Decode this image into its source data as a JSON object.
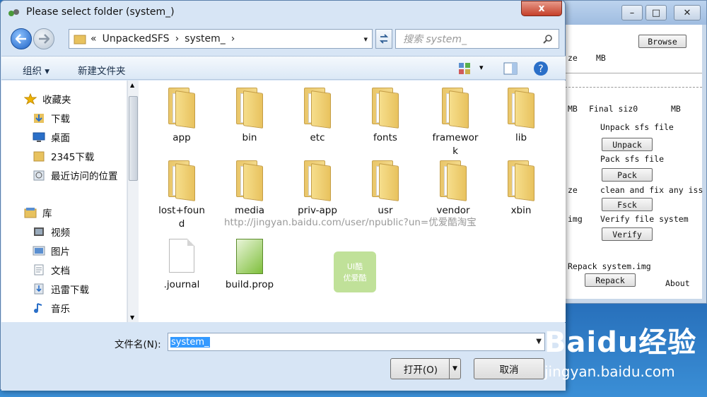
{
  "dialog": {
    "title": "Please select folder (system_)",
    "close_label": "x",
    "address": {
      "crumbs": [
        "«",
        "UnpackedSFS",
        "›",
        "system_",
        "›"
      ],
      "dropdown": "▾"
    },
    "refresh_icon": "refresh-icon",
    "search_placeholder": "搜索 system_",
    "toolbar": {
      "organize": "组织 ▾",
      "new_folder": "新建文件夹"
    },
    "nav": {
      "favorites_label": "收藏夹",
      "favorites": [
        "下载",
        "桌面",
        "2345下载",
        "最近访问的位置"
      ],
      "library_label": "库",
      "library": [
        "视频",
        "图片",
        "文档",
        "迅雷下载",
        "音乐"
      ]
    },
    "files": [
      {
        "name": "app",
        "type": "folder"
      },
      {
        "name": "bin",
        "type": "folder"
      },
      {
        "name": "etc",
        "type": "folder"
      },
      {
        "name": "fonts",
        "type": "folder"
      },
      {
        "name": "framework",
        "type": "folder"
      },
      {
        "name": "lib",
        "type": "folder"
      },
      {
        "name": "lost+found",
        "type": "folder"
      },
      {
        "name": "media",
        "type": "folder"
      },
      {
        "name": "priv-app",
        "type": "folder"
      },
      {
        "name": "usr",
        "type": "folder"
      },
      {
        "name": "vendor",
        "type": "folder"
      },
      {
        "name": "xbin",
        "type": "folder"
      },
      {
        "name": ".journal",
        "type": "file"
      },
      {
        "name": "build.prop",
        "type": "prop"
      }
    ],
    "filename_label": "文件名(N):",
    "filename_value": "system_",
    "open_label": "打开(O)",
    "cancel_label": "取消"
  },
  "background_tool": {
    "browse": "Browse",
    "size_label": "ze",
    "mb1": "MB",
    "mb2": "MB",
    "final_size": "Final siz0",
    "mb3": "MB",
    "unpack_title": "Unpack sfs file",
    "unpack": "Unpack",
    "pack_title": "Pack sfs file",
    "pack": "Pack",
    "ze2": "ze",
    "clean_title": "clean and fix any iss",
    "fsck": "Fsck",
    "img": "img",
    "verify_title": "Verify file system",
    "verify": "Verify",
    "repack_title": "Repack system.img",
    "repack": "Repack",
    "about": "About",
    "minimize": "–",
    "maximize": "□",
    "close": "✕"
  },
  "watermark": {
    "url": "http://jingyan.baidu.com/user/npublic?un=优爱酷淘宝",
    "logo_top": "UI酷",
    "logo_bottom": "优爱酷"
  },
  "baidu": {
    "logo": "Baidu经验",
    "url": "jingyan.baidu.com"
  }
}
